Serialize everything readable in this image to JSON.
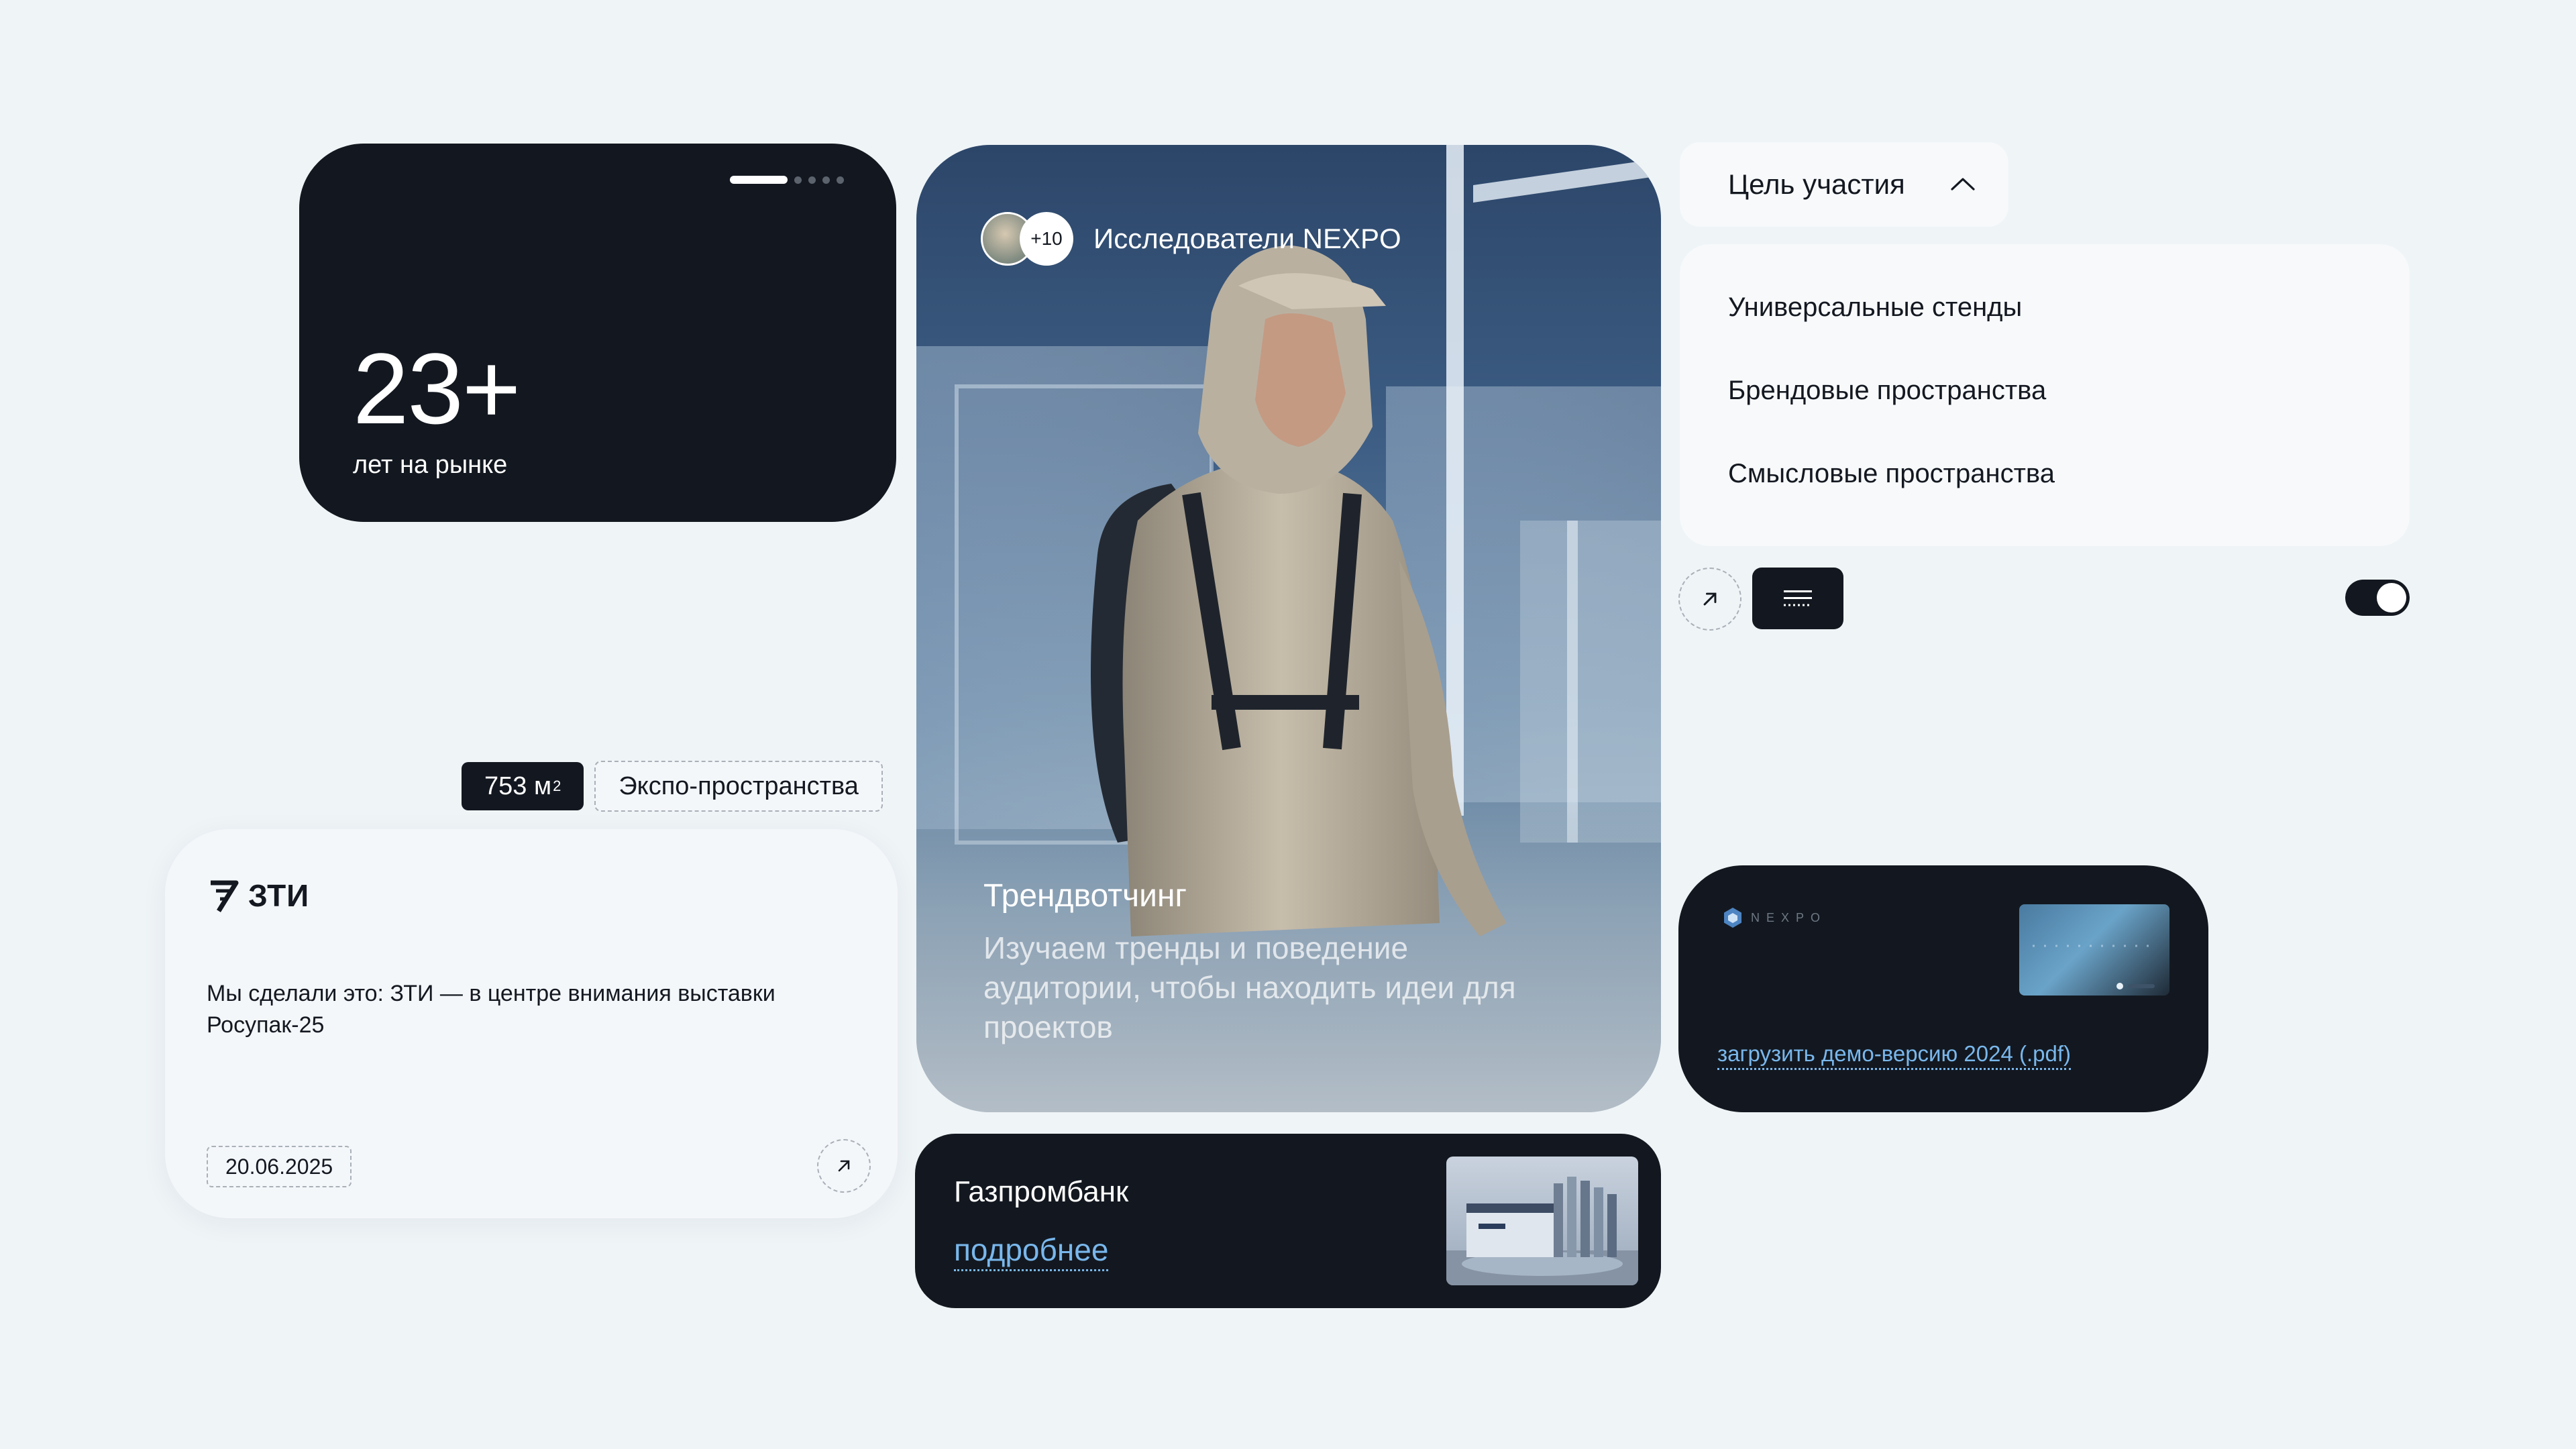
{
  "stat_card": {
    "value": "23+",
    "label": "лет на рынке"
  },
  "tags": {
    "area": "753 м",
    "area_sup": "2",
    "category": "Экспо-пространства"
  },
  "news_card": {
    "logo_text": "ЗТИ",
    "text": "Мы сделали это: ЗТИ — в центре внимания выставки Росупак-25",
    "date": "20.06.2025"
  },
  "hero": {
    "avatar_count": "+10",
    "badge_label": "Исследователи NEXPO",
    "title": "Трендвотчинг",
    "description": "Изучаем тренды и поведение аудитории, чтобы находить идеи для проектов"
  },
  "bank_card": {
    "title": "Газпромбанк",
    "link": "подробнее"
  },
  "dropdown": {
    "label": "Цель участия",
    "options": [
      "Универсальные стенды",
      "Брендовые пространства",
      "Смысловые пространства"
    ]
  },
  "toggle": {
    "on": true
  },
  "download_card": {
    "logo_text": "NEXPO",
    "link": "загрузить демо-версию 2024 (.pdf)"
  },
  "colors": {
    "background": "#eff4f7",
    "dark": "#131820",
    "card_light": "#f4f7fa",
    "link": "#79b7ec"
  },
  "icons": {
    "arrow": "arrow-up-right-icon",
    "chevron": "chevron-up-icon",
    "menu": "menu-icon"
  }
}
